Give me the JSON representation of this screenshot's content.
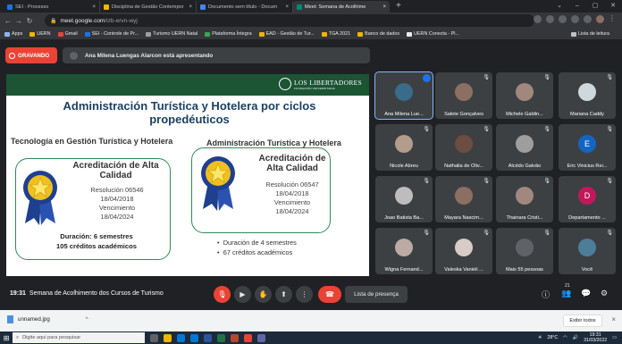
{
  "browser": {
    "tabs": [
      {
        "label": "SEI - Processo",
        "color": "#1a73e8"
      },
      {
        "label": "Disciplina de Gestão Contempor",
        "color": "#f4b400"
      },
      {
        "label": "Documento sem título - Docum",
        "color": "#4285f4"
      },
      {
        "label": "Meet: Semana de Acolhime",
        "color": "#00897b",
        "active": true
      }
    ],
    "new_tab": "+",
    "url_host": "meet.google.com",
    "url_path": "/izb-ervn-wyj",
    "bookmarks": [
      "Apps",
      "UERN",
      "Gmail",
      "SEI - Controle de Pr...",
      "Turismo UERN Natal",
      "Plataforma Íntegra",
      "EAD - Gestão de Tur...",
      "TGA 2021",
      "Banco de dados",
      "UERN Conecta - Pl..."
    ],
    "reading_list": "Lista de leitura"
  },
  "meet": {
    "recording_label": "GRAVANDO",
    "presenting_text": "Ana Milena Luengas Alarcon está apresentando",
    "time": "19:31",
    "meeting_name": "Semana de Acolhimento dos Cursos de Turismo",
    "present_tip": "Lista de presença",
    "participant_count": "21",
    "participants": [
      {
        "name": "Ana Milena Lue...",
        "color": "#3b6b8a",
        "active": true
      },
      {
        "name": "Salete Gonçalves",
        "color": "#8d6e63"
      },
      {
        "name": "Michele Galdin...",
        "color": "#a1887f"
      },
      {
        "name": "Mariana Caddy",
        "color": "#cfd8dc"
      },
      {
        "name": "Nicole Abreu",
        "color": "#b39c8c"
      },
      {
        "name": "Nathalia de Oliv...",
        "color": "#6d4c41"
      },
      {
        "name": "Alcédo Galvão",
        "color": "#9e9e9e"
      },
      {
        "name": "Eric Vinicius Rei...",
        "color": "#1565c0",
        "initial": "E"
      },
      {
        "name": "Joao Batista Ba...",
        "color": "#bdbdbd"
      },
      {
        "name": "Mayara Nascim...",
        "color": "#8d6e63"
      },
      {
        "name": "Thainara Cristi...",
        "color": "#a1887f"
      },
      {
        "name": "Departamento ...",
        "color": "#c2185b",
        "initial": "D"
      },
      {
        "name": "Wigna Fernand...",
        "color": "#bcaaa4"
      },
      {
        "name": "Valeska Vanieli ...",
        "color": "#d7ccc8"
      },
      {
        "name": "Mais 55 pessoas",
        "color": "#5f6368"
      },
      {
        "name": "Você",
        "color": "#4e7d9a"
      }
    ]
  },
  "slide": {
    "logo_name": "LOS LIBERTADORES",
    "logo_sub": "FUNDACIÓN UNIVERSITARIA",
    "title": "Administración Turística y Hotelera por ciclos propedéuticos",
    "left_heading": "Tecnología en Gestión Turística y Hotelera",
    "right_heading": "Administración Turística y Hotelera",
    "left_card": {
      "title": "Acreditación de Alta Calidad",
      "resolution": "Resolución 06546",
      "date": "18/04/2018",
      "valid_label": "Vencimiento",
      "valid_date": "18/04/2024",
      "duration": "Duración: 6 semestres",
      "credits": "105 créditos académicos"
    },
    "right_card": {
      "title": "Acreditación de Alta Calidad",
      "resolution": "Resolución 06547",
      "date": "18/04/2018",
      "valid_label": "Vencimiento",
      "valid_date": "18/04/2024",
      "duration": "Duración de 4 semestres",
      "credits": "67 créditos académicos"
    }
  },
  "downloads": {
    "file": "unnamed.jpg",
    "show_all": "Exibir todos"
  },
  "taskbar": {
    "search_placeholder": "Digite aqui para pesquisar",
    "temperature": "28°C",
    "time": "19:31",
    "date": "31/03/2022"
  }
}
